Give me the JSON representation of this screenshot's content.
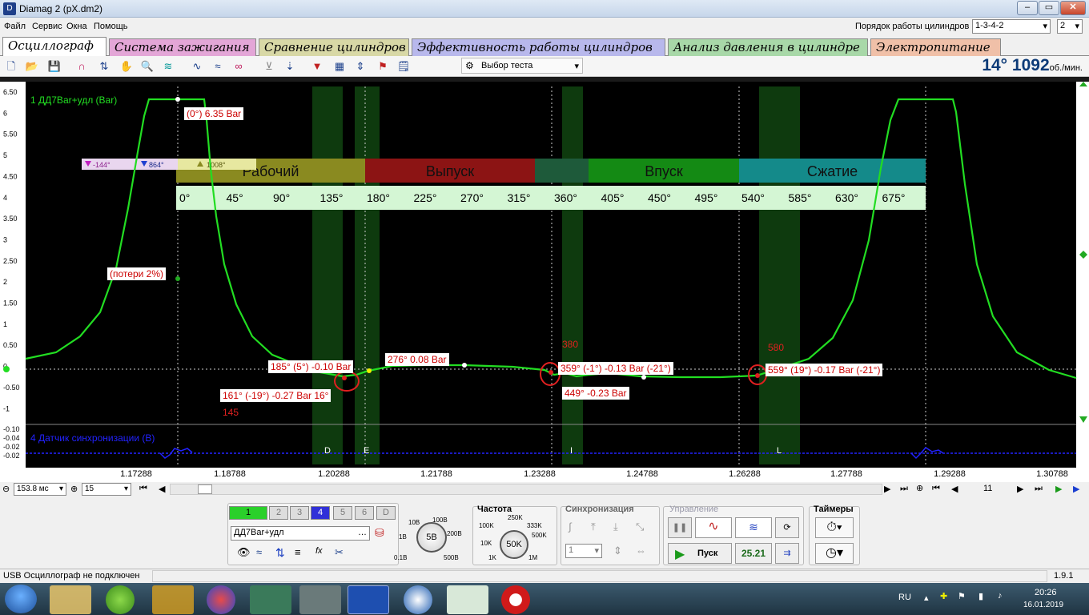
{
  "window": {
    "title": "Diamag 2 (pX.dm2)",
    "app_icon": "D"
  },
  "menu": [
    "Файл",
    "Сервис",
    "Окна",
    "Помощь"
  ],
  "cylinder_order": {
    "label": "Порядок работы цилиндров",
    "value": "1-3-4-2",
    "cylinder": "2"
  },
  "tabs": [
    {
      "label": "Осциллограф",
      "color": "#ffffff",
      "active": true
    },
    {
      "label": "Система зажигания",
      "color": "#e3a6d7"
    },
    {
      "label": "Сравнение цилиндров",
      "color": "#d8d8a6"
    },
    {
      "label": "Эффективность работы цилиндров",
      "color": "#b8b8ec"
    },
    {
      "label": "Анализ давления в цилиндре",
      "color": "#a8d8a8"
    },
    {
      "label": "Электропитание",
      "color": "#f0c0a8"
    }
  ],
  "toolbar": {
    "test_select": "Выбор теста",
    "rpm_value": "14° 1092",
    "rpm_unit": "об./мин."
  },
  "channel1": {
    "name": "1 ДД7Bar+удл (Bar)",
    "color": "#22dd22"
  },
  "channel4": {
    "name": "4 Датчик синхронизации (В)",
    "color": "#2222ff"
  },
  "y_ticks": [
    "6.50",
    "6",
    "5.50",
    "5",
    "4.50",
    "4",
    "3.50",
    "3",
    "2.50",
    "2",
    "1.50",
    "1",
    "0.50",
    "0",
    "-0.50",
    "-1"
  ],
  "y2_ticks": [
    "-0.10",
    "-0.04",
    "-0.02",
    "-0.02"
  ],
  "x_ticks": [
    "1.17288",
    "1.18788",
    "1.20288",
    "1.21788",
    "1.23288",
    "1.24788",
    "1.26288",
    "1.27788",
    "1.29288",
    "1.30788"
  ],
  "phases": [
    {
      "label": "Рабочий",
      "color": "#8a8a20"
    },
    {
      "label": "Выпуск",
      "color": "#8c1414"
    },
    {
      "label": "",
      "color": "#1e5a3a"
    },
    {
      "label": "Впуск",
      "color": "#148a14"
    },
    {
      "label": "Сжатие",
      "color": "#148a8a"
    }
  ],
  "degree_ticks": [
    "0°",
    "45°",
    "90°",
    "135°",
    "180°",
    "225°",
    "270°",
    "315°",
    "360°",
    "405°",
    "450°",
    "495°",
    "540°",
    "585°",
    "630°",
    "675°"
  ],
  "markers": [
    {
      "label": "-144°",
      "color": "#c020c0"
    },
    {
      "label": "864°",
      "color": "#2040d0"
    },
    {
      "label": "1008°",
      "color": "#c0c020"
    }
  ],
  "annotations": [
    "(0°) 6.35 Bar",
    "(потери 2%)",
    "185° (5°) -0.10 Bar",
    "276° 0.08 Bar",
    "161° (-19°) -0.27 Bar 16°",
    "359° (-1°) -0.13 Bar (-21°)",
    "449° -0.23 Bar",
    "559° (19°) -0.17 Bar (-21°)"
  ],
  "red_numbers": [
    "145",
    "380",
    "580"
  ],
  "zone_letters": [
    "D",
    "E",
    "I",
    "L"
  ],
  "time_scale": {
    "value": "153.8 мс",
    "count": "15",
    "page": "11"
  },
  "bottom": {
    "channels": [
      "1",
      "2",
      "3",
      "4",
      "5",
      "6",
      "D"
    ],
    "channel_name": "ДД7Bar+удл",
    "volt_dial": {
      "center": "5В",
      "labels": [
        "10В",
        "100В",
        "1В",
        "200В",
        "0.1В",
        "500В"
      ]
    },
    "freq_title": "Частота",
    "freq_dial": {
      "center": "50K",
      "labels": [
        "250K",
        "100K",
        "333K",
        "10K",
        "500K",
        "1K",
        "1M"
      ]
    },
    "sync_title": "Синхронизация",
    "sync_value": "1",
    "control_title": "Управление",
    "start_label": "Пуск",
    "fps": "25.21",
    "timers_title": "Таймеры"
  },
  "status": {
    "text": "USB Осциллограф не подключен",
    "version": "1.9.1"
  },
  "taskbar": {
    "lang": "RU",
    "time": "20:26",
    "date": "16.01.2019"
  }
}
